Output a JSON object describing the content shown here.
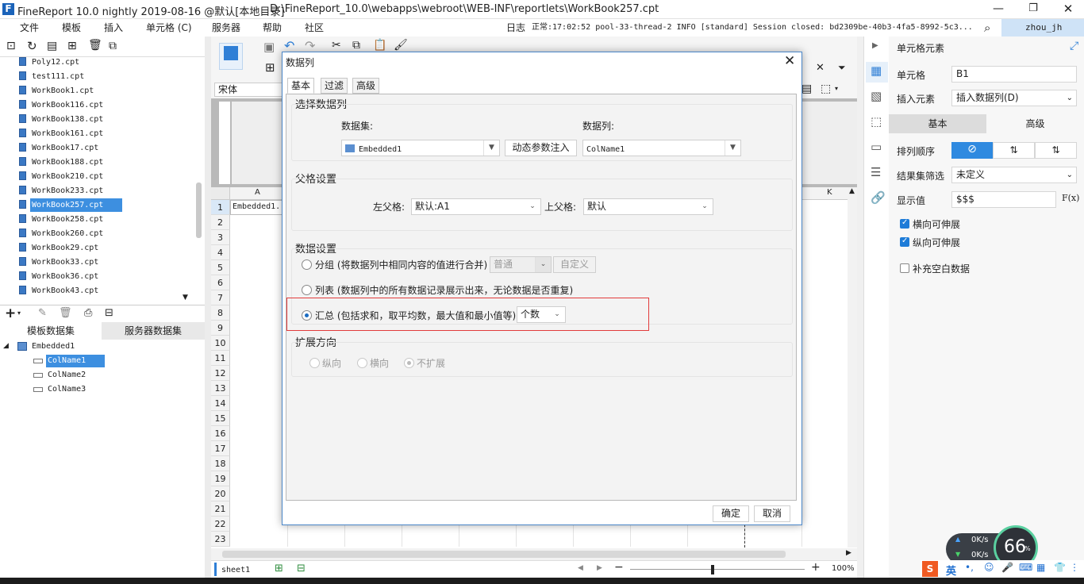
{
  "titlebar": {
    "title": "FineReport 10.0 nightly 2019-08-16 @默认[本地目录]",
    "path": "D:\\FineReport_10.0\\webapps\\webroot\\WEB-INF\\reportlets\\WorkBook257.cpt"
  },
  "menubar": {
    "items": [
      "文件",
      "模板",
      "插入",
      "单元格 (C)",
      "服务器",
      "帮助",
      "社区"
    ],
    "log_label": "日志",
    "log_text": "正常:17:02:52 pool-33-thread-2 INFO [standard] Session closed: bd2309be-40b3-4fa5-8992-5c3...",
    "user": "zhou_jh"
  },
  "files": [
    "Poly12.cpt",
    "test111.cpt",
    "WorkBook1.cpt",
    "WorkBook116.cpt",
    "WorkBook138.cpt",
    "WorkBook161.cpt",
    "WorkBook17.cpt",
    "WorkBook188.cpt",
    "WorkBook210.cpt",
    "WorkBook233.cpt",
    "WorkBook257.cpt",
    "WorkBook258.cpt",
    "WorkBook260.cpt",
    "WorkBook29.cpt",
    "WorkBook33.cpt",
    "WorkBook36.cpt",
    "WorkBook43.cpt"
  ],
  "dataset_tabs": {
    "template": "模板数据集",
    "server": "服务器数据集"
  },
  "dataset_tree": {
    "root": "Embedded1",
    "columns": [
      "ColName1",
      "ColName2",
      "ColName3"
    ]
  },
  "font_name": "宋体",
  "grid": {
    "col_a": "A",
    "col_k": "K",
    "cell_a1": "Embedded1.",
    "rows": [
      "1",
      "2",
      "3",
      "4",
      "5",
      "6",
      "7",
      "8",
      "9",
      "10",
      "11",
      "12",
      "13",
      "14",
      "15",
      "16",
      "17",
      "18",
      "19",
      "20",
      "21",
      "22",
      "23"
    ]
  },
  "bottombar": {
    "sheet": "sheet1",
    "zoom": "100%"
  },
  "right_panel": {
    "header": "单元格元素",
    "cell_label": "单元格",
    "cell_value": "B1",
    "insert_label": "插入元素",
    "insert_value": "插入数据列(D)",
    "tab_basic": "基本",
    "tab_advanced": "高级",
    "sort_label": "排列顺序",
    "filter_label": "结果集筛选",
    "filter_value": "未定义",
    "display_label": "显示值",
    "display_value": "$$$",
    "fx": "F(x)",
    "chk_horizontal": "横向可伸展",
    "chk_vertical": "纵向可伸展",
    "chk_fill": "补充空白数据"
  },
  "status_widget": {
    "up": "0K/s",
    "down": "0K/s",
    "percent": "66",
    "unit": "%",
    "ime": "英"
  },
  "dialog": {
    "title": "数据列",
    "tabs": [
      "基本",
      "过滤",
      "高级"
    ],
    "select_section": "选择数据列",
    "dataset_label": "数据集:",
    "dataset_value": "Embedded1",
    "param_button": "动态参数注入",
    "column_label": "数据列:",
    "column_value": "ColName1",
    "parent_section": "父格设置",
    "left_parent_label": "左父格:",
    "left_parent_value": "默认:A1",
    "top_parent_label": "上父格:",
    "top_parent_value": "默认",
    "data_section": "数据设置",
    "opt_group": "分组 (将数据列中相同内容的值进行合并)",
    "opt_group_mode": "普通",
    "opt_group_custom": "自定义",
    "opt_list": "列表 (数据列中的所有数据记录展示出来，无论数据是否重复)",
    "opt_summary": "汇总 (包括求和，取平均数，最大值和最小值等)",
    "summary_func": "个数",
    "expand_section": "扩展方向",
    "expand_vertical": "纵向",
    "expand_horizontal": "横向",
    "expand_none": "不扩展",
    "ok": "确定",
    "cancel": "取消"
  }
}
